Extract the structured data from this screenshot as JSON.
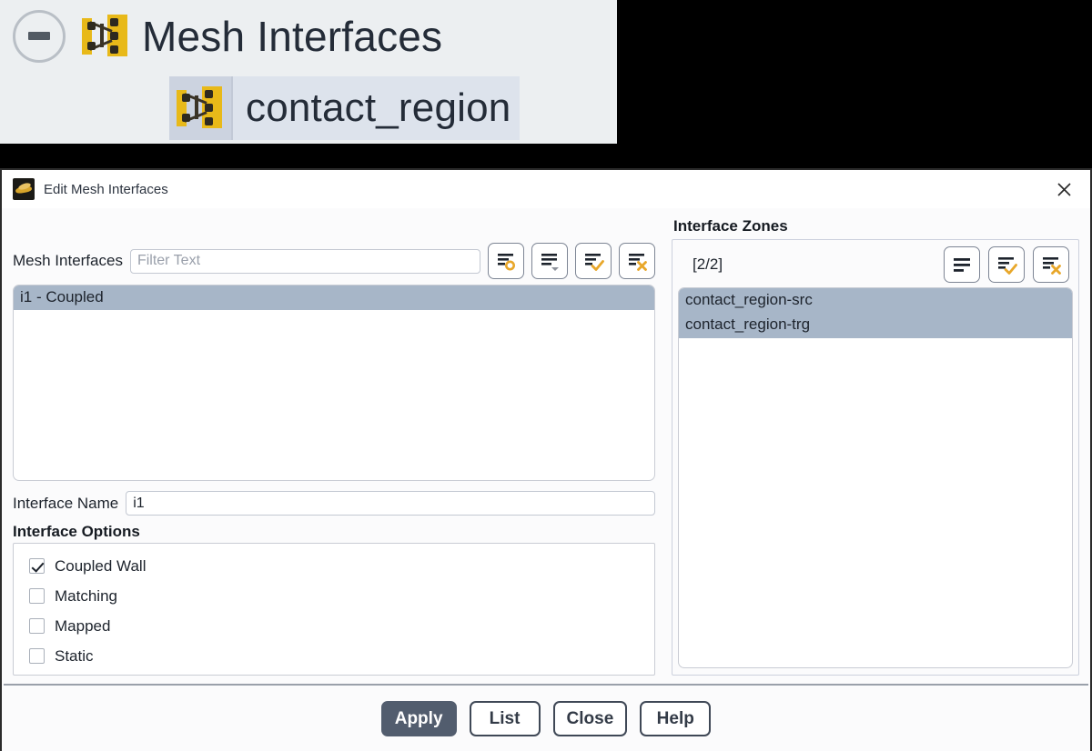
{
  "tree": {
    "collapse_icon": "minus-circle-icon",
    "parent_icon": "mesh-interface-icon",
    "parent_label": "Mesh Interfaces",
    "child_icon": "mesh-interface-icon",
    "child_label": "contact_region"
  },
  "dialog": {
    "app_icon": "fluent-logo-icon",
    "title": "Edit Mesh Interfaces",
    "close_icon": "close-icon"
  },
  "mesh_interfaces": {
    "label": "Mesh Interfaces",
    "filter_placeholder": "Filter Text",
    "filter_value": "",
    "toolbar": [
      {
        "name": "new-list-icon",
        "title": "New"
      },
      {
        "name": "list-dropdown-icon",
        "title": "List Options"
      },
      {
        "name": "list-check-icon",
        "title": "Select All"
      },
      {
        "name": "list-delete-icon",
        "title": "Delete"
      }
    ],
    "items": [
      {
        "text": "i1 - Coupled",
        "selected": true
      }
    ]
  },
  "interface_name": {
    "label": "Interface Name",
    "value": "i1"
  },
  "interface_options": {
    "header": "Interface Options",
    "items": [
      {
        "label": "Coupled Wall",
        "checked": true
      },
      {
        "label": "Matching",
        "checked": false
      },
      {
        "label": "Mapped",
        "checked": false
      },
      {
        "label": "Static",
        "checked": false
      }
    ]
  },
  "interface_zones": {
    "title": "Interface Zones",
    "count": "[2/2]",
    "toolbar": [
      {
        "name": "list-icon",
        "title": "List"
      },
      {
        "name": "list-check-icon",
        "title": "Select All"
      },
      {
        "name": "list-delete-icon",
        "title": "Deselect All"
      }
    ],
    "items": [
      {
        "text": "contact_region-src",
        "selected": true
      },
      {
        "text": "contact_region-trg",
        "selected": true
      }
    ]
  },
  "footer": {
    "buttons": [
      {
        "label": "Apply",
        "primary": true
      },
      {
        "label": "List",
        "primary": false
      },
      {
        "label": "Close",
        "primary": false
      },
      {
        "label": "Help",
        "primary": false
      }
    ]
  },
  "colors": {
    "accent_gold": "#e8a72a",
    "selection_blue_grey": "#a7b6c8",
    "tree_selection": "#ccd3e0",
    "primary_button": "#525d6e",
    "panel_bg": "#fbfbfc"
  }
}
